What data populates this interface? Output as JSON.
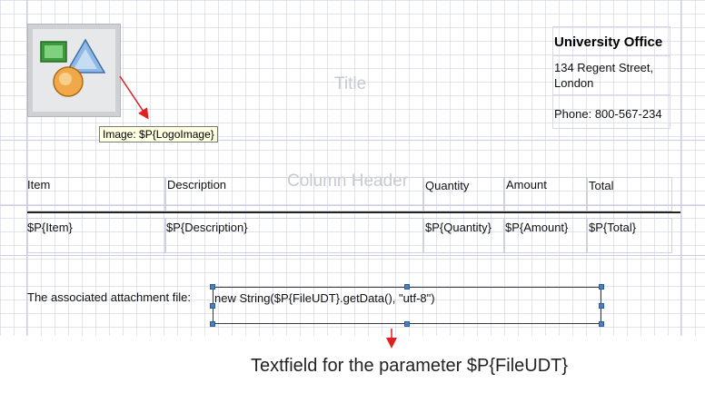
{
  "report": {
    "title_band": "Title",
    "column_header_band": "Column Header",
    "logo_tooltip": "Image: $P{LogoImage}",
    "office": {
      "name": "University Office",
      "address": "134 Regent Street, London",
      "phone": "Phone: 800-567-234"
    },
    "headers": [
      "Item",
      "Description",
      "Quantity",
      "Amount",
      "Total"
    ],
    "fields": [
      "$P{Item}",
      "$P{Description}",
      "$P{Quantity}",
      "$P{Amount}",
      "$P{Total}"
    ],
    "attachment_label": "The associated attachment file:",
    "attachment_expression": "new String($P{FileUDT}.getData(), \"utf-8\")"
  },
  "annotations": {
    "caption": "Textfield for the parameter $P{FileUDT}",
    "arrow_color": "#e02020"
  }
}
